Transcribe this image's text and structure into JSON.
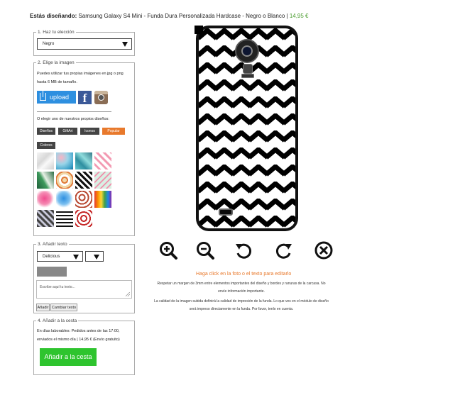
{
  "header": {
    "label": "Estás diseñando:",
    "product": " Samsung Galaxy S4 Mini - Funda Dura Personalizada Hardcase - Negro o Blanco | ",
    "price": "14,95 €"
  },
  "step1": {
    "legend": "1. Haz tu elección",
    "select_value": "Negro"
  },
  "step2": {
    "legend": "2. Elige la imagen",
    "info_line1": "Puedes utilizar tus propias imágenes en jpg o png",
    "info_line2": "hasta 6 MB de tamaño.",
    "upload_label": "upload",
    "facebook_glyph": "f",
    "or_text": "O elegir uno de nuestros propios diseños:",
    "categories": [
      "Diseños",
      "GiftArt",
      "Iconos",
      "Popular",
      "Colores"
    ],
    "active_category": "Popular",
    "thumbnails": [
      "marble-white",
      "watercolor-blue",
      "tropical-teal",
      "flamingo-pink",
      "palm-leaves",
      "tacos-pattern",
      "chevron-bw",
      "flamingo-green",
      "pink-heart",
      "blue-heart",
      "lips-pattern",
      "rainbow-drip",
      "chevron-gray",
      "stripes-bw",
      "lips-red"
    ]
  },
  "step3": {
    "legend": "3. Añadir texto",
    "font_value": "Delicious",
    "textarea_placeholder": "Escribe aquí tu texto...",
    "add_button": "Añadir",
    "change_button": "Cambiar texto"
  },
  "step4": {
    "legend": "4. Añadir a la cesta",
    "info_line1": "En días laborables: Pedidos antes de las 17:00,",
    "info_line2": "enviados el mismo día | 14,95 € (Envío gratuito)",
    "cart_button": "Añadir a la cesta"
  },
  "editor": {
    "tools": [
      "zoom-in-icon",
      "zoom-out-icon",
      "rotate-left-icon",
      "rotate-right-icon",
      "delete-icon"
    ],
    "hint": "Haga click en la foto o el texto para editarlo",
    "note1_line1": "Respetar un margen de 3mm entre elementos importantes del diseño y bordes y ranuras de la carcasa. No",
    "note1_line2": "envíe información importante.",
    "note2_line1": "La calidad de la imagen subida definirá la calidad de impresión de la funda. Lo que ves en el módulo de diseño",
    "note2_line2": "será impreso directamente en la funda. Por favor, tenlo en cuenta."
  },
  "colors": {
    "accent": "#e8792c",
    "price": "#4a9c2e",
    "upload": "#2d8fe0",
    "cart": "#2ec42e"
  }
}
